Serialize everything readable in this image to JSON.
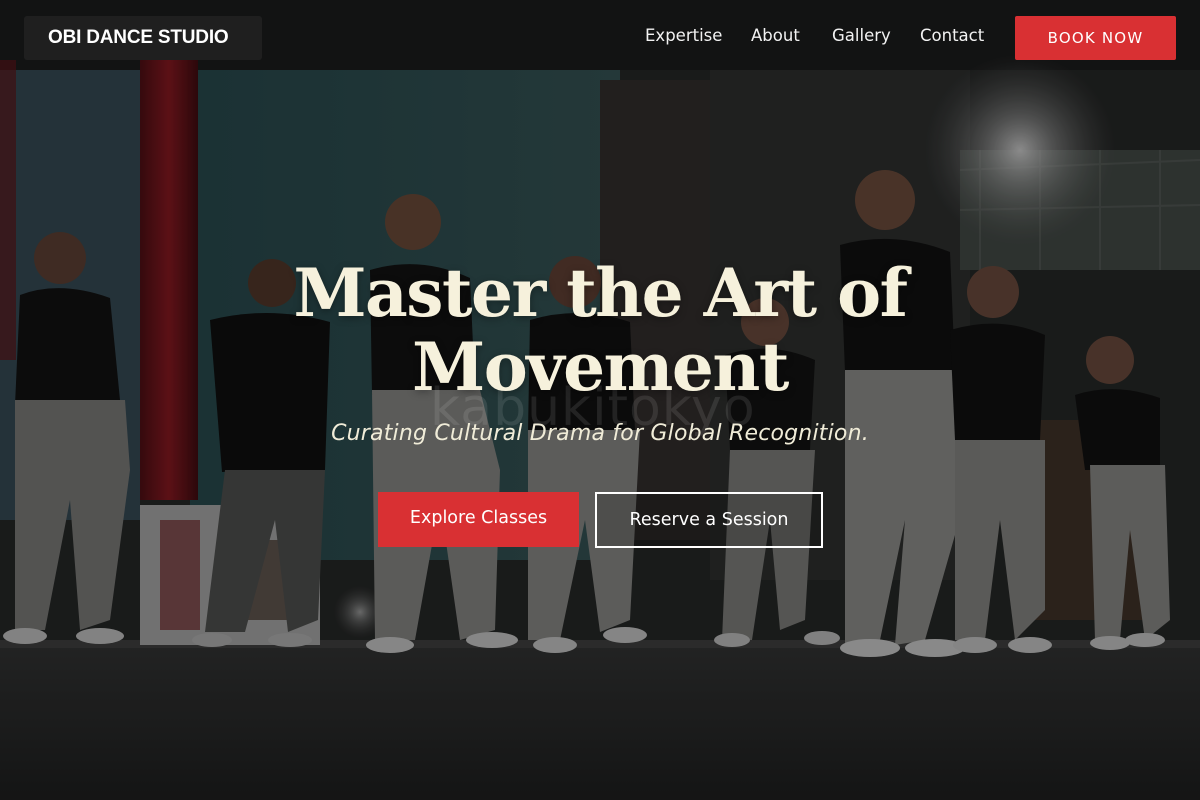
{
  "brand": {
    "name": "OBI DANCE STUDIO"
  },
  "nav": {
    "items": [
      {
        "label": "Expertise"
      },
      {
        "label": "About"
      },
      {
        "label": "Gallery"
      },
      {
        "label": "Contact"
      }
    ],
    "cta_label": "BOOK NOW"
  },
  "hero": {
    "title": "Master the Art of Movement",
    "subtitle": "Curating Cultural Drama for Global Recognition.",
    "primary_button": "Explore Classes",
    "secondary_button": "Reserve a Session",
    "photo_watermark": "kabukitokyo",
    "background_image": "dancers-performing-on-stage"
  },
  "colors": {
    "accent": "#d93033",
    "title_text": "#f6f1dc",
    "brand_bg": "#1f1f1f"
  }
}
